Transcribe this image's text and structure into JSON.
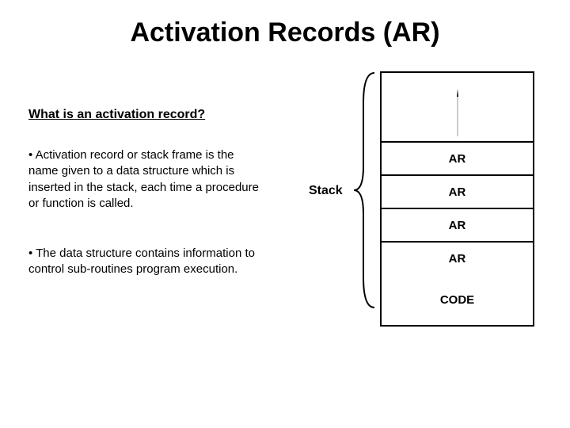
{
  "title": "Activation Records (AR)",
  "subtitle": "What is an activation record?",
  "bullets": [
    "• Activation record or stack frame is the name given to a data structure which is inserted in the stack, each time a procedure or function is called.",
    "• The data structure contains information to control  sub-routines program execution."
  ],
  "stack_label": "Stack",
  "rows": {
    "ar1": "AR",
    "ar2": "AR",
    "ar3": "AR",
    "ar4": "AR",
    "code": "CODE"
  }
}
